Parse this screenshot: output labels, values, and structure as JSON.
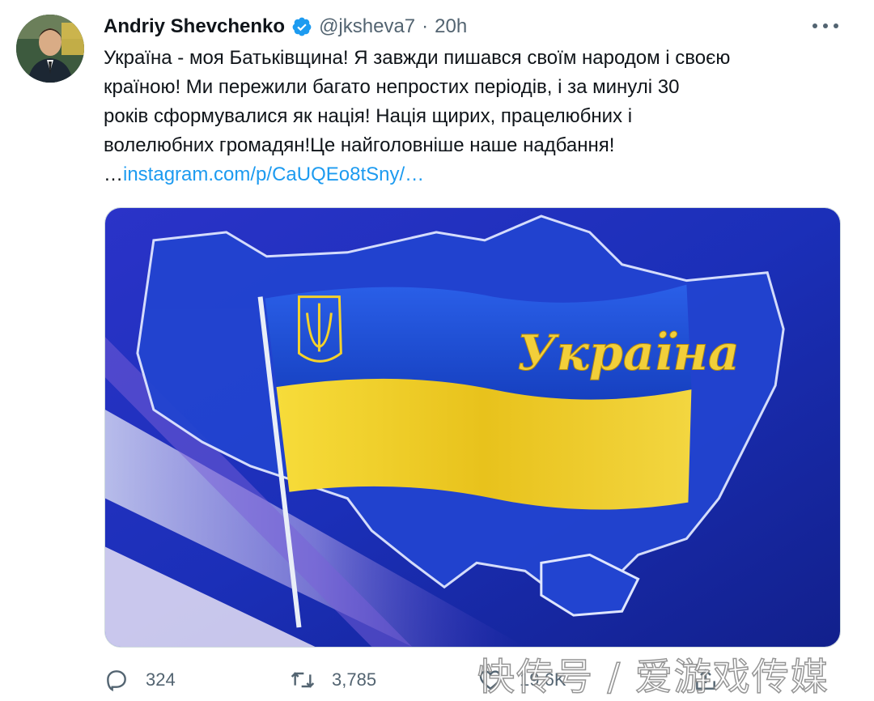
{
  "author": {
    "name": "Andriy Shevchenko",
    "handle": "@jksheva7",
    "separator": "·",
    "time": "20h",
    "verified": true,
    "verified_color": "#1d9bf0"
  },
  "tweet": {
    "lines": [
      "Україна - моя Батьківщина! Я завжди пишався своїм народом і своєю",
      "країною! Ми пережили багато непростих періодів, і  за минулі 30",
      "років сформувалися як нація! Нація щирих, працелюбних і",
      "волелюбних громадян!Це найголовніше наше надбання!"
    ],
    "link_prefix": "…",
    "link_text": "instagram.com/p/CaUQEo8tSny/…"
  },
  "media": {
    "caption_text": "Україна",
    "flag_colors": {
      "blue": "#1d4fd6",
      "yellow": "#f5d22a"
    }
  },
  "actions": {
    "reply_count": "324",
    "retweet_count": "3,785",
    "like_count": "19.6K"
  },
  "watermark": "快传号 / 爱游戏传媒",
  "colors": {
    "text": "#0f1419",
    "secondary": "#536471",
    "link": "#1d9bf0"
  },
  "icons": [
    "verified-badge-icon",
    "more-icon",
    "reply-icon",
    "retweet-icon",
    "like-icon",
    "share-icon"
  ]
}
